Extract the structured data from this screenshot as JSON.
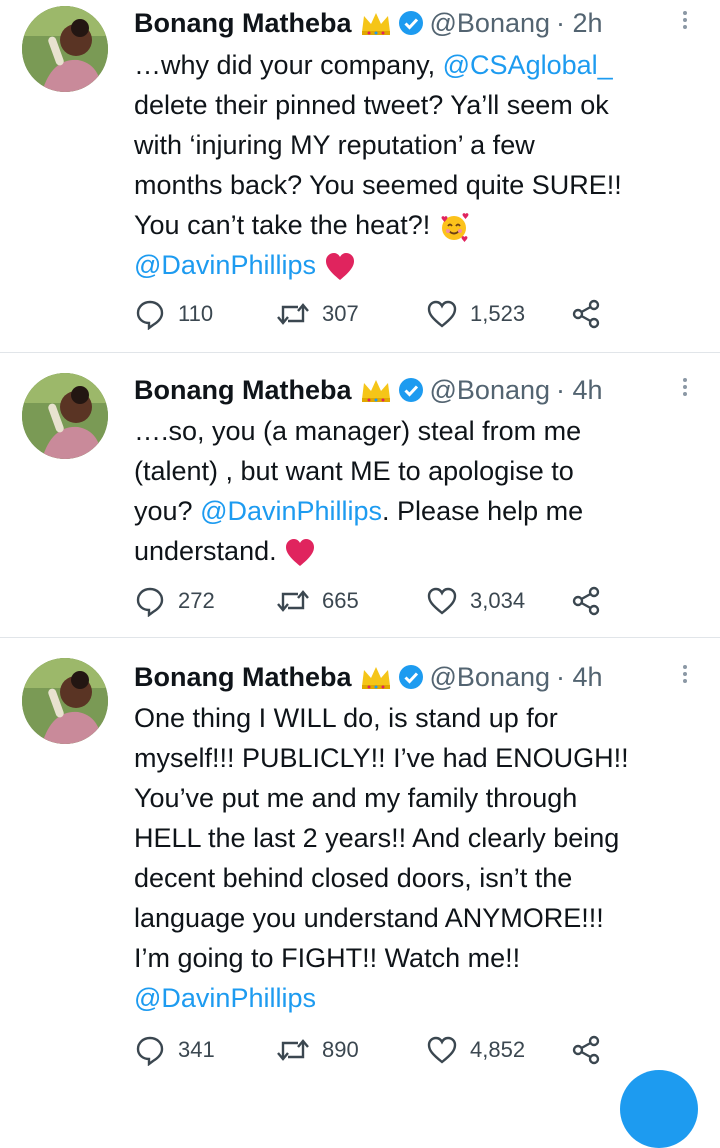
{
  "tweets": [
    {
      "name": "Bonang Matheba",
      "handle": "@Bonang",
      "time": "· 2h",
      "lines": [
        [
          "…why did your company, ",
          {
            "m": "@CSAglobal_"
          }
        ],
        [
          "delete their pinned tweet? Ya’ll seem ok"
        ],
        [
          "with ‘injuring MY reputation’ a few"
        ],
        [
          "months back? You seemed quite SURE!!"
        ],
        [
          "You can’t take the heat?! ",
          {
            "e": "smiling-hearts"
          }
        ],
        [
          {
            "m": "@DavinPhillips"
          },
          " ",
          {
            "e": "red-heart"
          }
        ]
      ],
      "replies": "110",
      "retweets": "307",
      "likes": "1,523"
    },
    {
      "name": "Bonang Matheba",
      "handle": "@Bonang",
      "time": "· 4h",
      "lines": [
        [
          "….so, you (a manager) steal from me"
        ],
        [
          "(talent) , but want ME to apologise to"
        ],
        [
          "you? ",
          {
            "m": "@DavinPhillips"
          },
          ". Please help me"
        ],
        [
          "understand. ",
          {
            "e": "red-heart"
          }
        ]
      ],
      "replies": "272",
      "retweets": "665",
      "likes": "3,034"
    },
    {
      "name": "Bonang Matheba",
      "handle": "@Bonang",
      "time": "· 4h",
      "lines": [
        [
          "One thing I WILL do, is stand up for"
        ],
        [
          "myself!!! PUBLICLY!! I’ve had ENOUGH!!"
        ],
        [
          "You’ve put me and my family through"
        ],
        [
          "HELL the last 2 years!! And clearly being"
        ],
        [
          "decent behind closed doors, isn’t the"
        ],
        [
          "language you understand ANYMORE!!!"
        ],
        [
          "I’m going to FIGHT!! Watch me!!"
        ],
        [
          {
            "m": "@DavinPhillips"
          }
        ]
      ],
      "replies": "341",
      "retweets": "890",
      "likes": "4,852"
    }
  ],
  "colors": {
    "accent": "#1d9bf0",
    "text": "#0f1419",
    "muted": "#536471",
    "heart": "#e0245e",
    "crown": "#f5c518"
  }
}
